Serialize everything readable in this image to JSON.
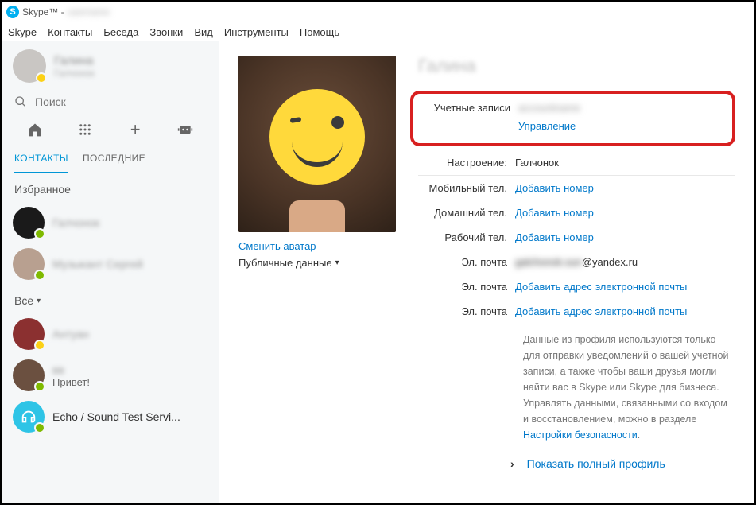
{
  "window": {
    "title": "Skype™ -"
  },
  "menu": [
    "Skype",
    "Контакты",
    "Беседа",
    "Звонки",
    "Вид",
    "Инструменты",
    "Помощь"
  ],
  "sidebar": {
    "me": {
      "name": "Галина",
      "sub": "Галчонок"
    },
    "search_placeholder": "Поиск",
    "tabs": {
      "contacts": "КОНТАКТЫ",
      "recent": "ПОСЛЕДНИЕ"
    },
    "sections": {
      "favorites": "Избранное",
      "all": "Все"
    },
    "favorites": [
      {
        "name": "Галчонок",
        "status": "online"
      },
      {
        "name": "Музыкант Сергей",
        "status": "online"
      }
    ],
    "all": [
      {
        "name": "Антуан",
        "status": "away",
        "sub": ""
      },
      {
        "name": "вв",
        "status": "online",
        "sub": "Привет!"
      },
      {
        "name": "Echo / Sound Test Servi...",
        "status": "online",
        "sub": ""
      }
    ]
  },
  "profile": {
    "name": "Галина",
    "change_avatar": "Сменить аватар",
    "public_data": "Публичные данные",
    "accounts": {
      "label": "Учетные записи",
      "value": "",
      "manage": "Управление"
    },
    "mood": {
      "label": "Настроение:",
      "value": "Галчонок"
    },
    "mobile": {
      "label": "Мобильный тел.",
      "link": "Добавить номер"
    },
    "home": {
      "label": "Домашний тел.",
      "link": "Добавить номер"
    },
    "work": {
      "label": "Рабочий тел.",
      "link": "Добавить номер"
    },
    "email1": {
      "label": "Эл. почта",
      "value": "g*********@yandex.ru"
    },
    "email2": {
      "label": "Эл. почта",
      "link": "Добавить адрес электронной почты"
    },
    "email3": {
      "label": "Эл. почта",
      "link": "Добавить адрес электронной почты"
    },
    "note_text": "Данные из профиля используются только для отправки уведомлений о вашей учетной записи, а также чтобы ваши друзья могли найти вас в Skype или Skype для бизнеса. Управлять данными, связанными со входом и восстановлением, можно в разделе ",
    "note_link": "Настройки безопасности",
    "show_full": "Показать полный профиль"
  }
}
